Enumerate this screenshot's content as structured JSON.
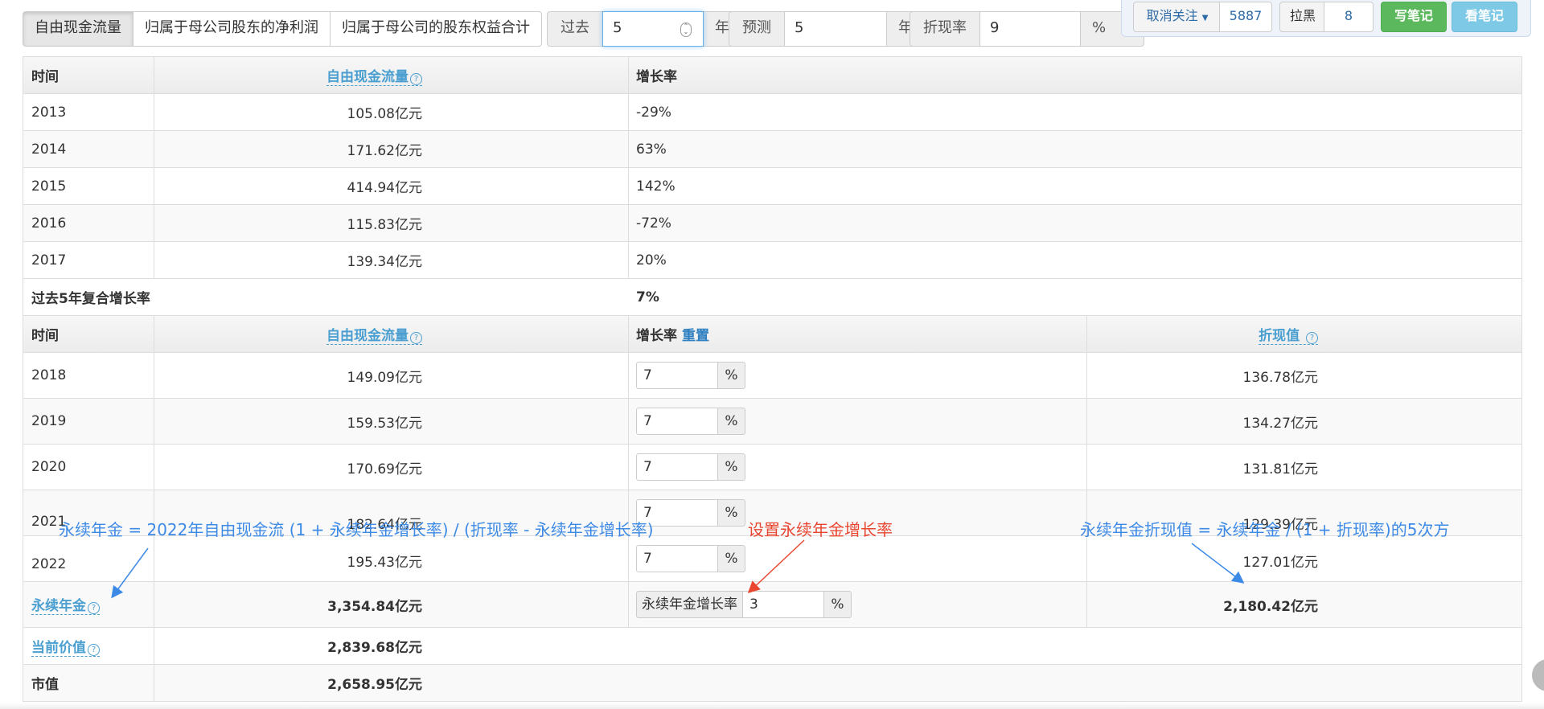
{
  "tabs": [
    {
      "label": "自由现金流量",
      "active": true
    },
    {
      "label": "归属于母公司股东的净利润",
      "active": false
    },
    {
      "label": "归属于母公司的股东权益合计",
      "active": false
    }
  ],
  "past": {
    "label": "过去",
    "value": "5",
    "unit": "年"
  },
  "forecast": {
    "label": "预测",
    "value": "5",
    "unit": "年"
  },
  "discount": {
    "label": "折现率",
    "value": "9",
    "unit": "%"
  },
  "follow": {
    "label": "取消关注",
    "count": "5887"
  },
  "block": {
    "label": "拉黑",
    "count": "8"
  },
  "write_note": "写笔记",
  "view_note": "看笔记",
  "history": {
    "header": {
      "time": "时间",
      "fcf": "自由现金流量",
      "growth": "增长率"
    },
    "rows": [
      {
        "year": "2013",
        "fcf": "105.08亿元",
        "growth": "-29%"
      },
      {
        "year": "2014",
        "fcf": "171.62亿元",
        "growth": "63%"
      },
      {
        "year": "2015",
        "fcf": "414.94亿元",
        "growth": "142%"
      },
      {
        "year": "2016",
        "fcf": "115.83亿元",
        "growth": "-72%"
      },
      {
        "year": "2017",
        "fcf": "139.34亿元",
        "growth": "20%"
      }
    ],
    "cagr_label": "过去5年复合增长率",
    "cagr_value": "7%"
  },
  "forecast_table": {
    "header": {
      "time": "时间",
      "fcf": "自由现金流量",
      "growth": "增长率",
      "reset": "重置",
      "pv": "折现值"
    },
    "rows": [
      {
        "year": "2018",
        "fcf": "149.09亿元",
        "growth": "7",
        "pct": "%",
        "pv": "136.78亿元"
      },
      {
        "year": "2019",
        "fcf": "159.53亿元",
        "growth": "7",
        "pct": "%",
        "pv": "134.27亿元"
      },
      {
        "year": "2020",
        "fcf": "170.69亿元",
        "growth": "7",
        "pct": "%",
        "pv": "131.81亿元"
      },
      {
        "year": "2021",
        "fcf": "182.64亿元",
        "growth": "7",
        "pct": "%",
        "pv": "129.39亿元"
      },
      {
        "year": "2022",
        "fcf": "195.43亿元",
        "growth": "7",
        "pct": "%",
        "pv": "127.01亿元"
      }
    ],
    "perpetuity": {
      "label": "永续年金",
      "value": "3,354.84亿元",
      "growth_label": "永续年金增长率",
      "growth_value": "3",
      "pct": "%",
      "pv": "2,180.42亿元"
    },
    "current_value": {
      "label": "当前价值",
      "value": "2,839.68亿元"
    },
    "market_cap": {
      "label": "市值",
      "value": "2,658.95亿元"
    }
  },
  "annotations": {
    "formula_perpetuity": "永续年金 = 2022年自由现金流  (1 + 永续年金增长率) / (折现率 - 永续年金增长率)",
    "set_growth": "设置永续年金增长率",
    "formula_pv": "永续年金折现值 = 永续年金 / (1 + 折现率)的5次方"
  },
  "colors": {
    "accent": "#4a9fd0",
    "annotation_blue": "#3d8ae6",
    "annotation_red": "#e8462f",
    "green_btn": "#5cb85c",
    "teal_btn": "#5bc0de"
  }
}
